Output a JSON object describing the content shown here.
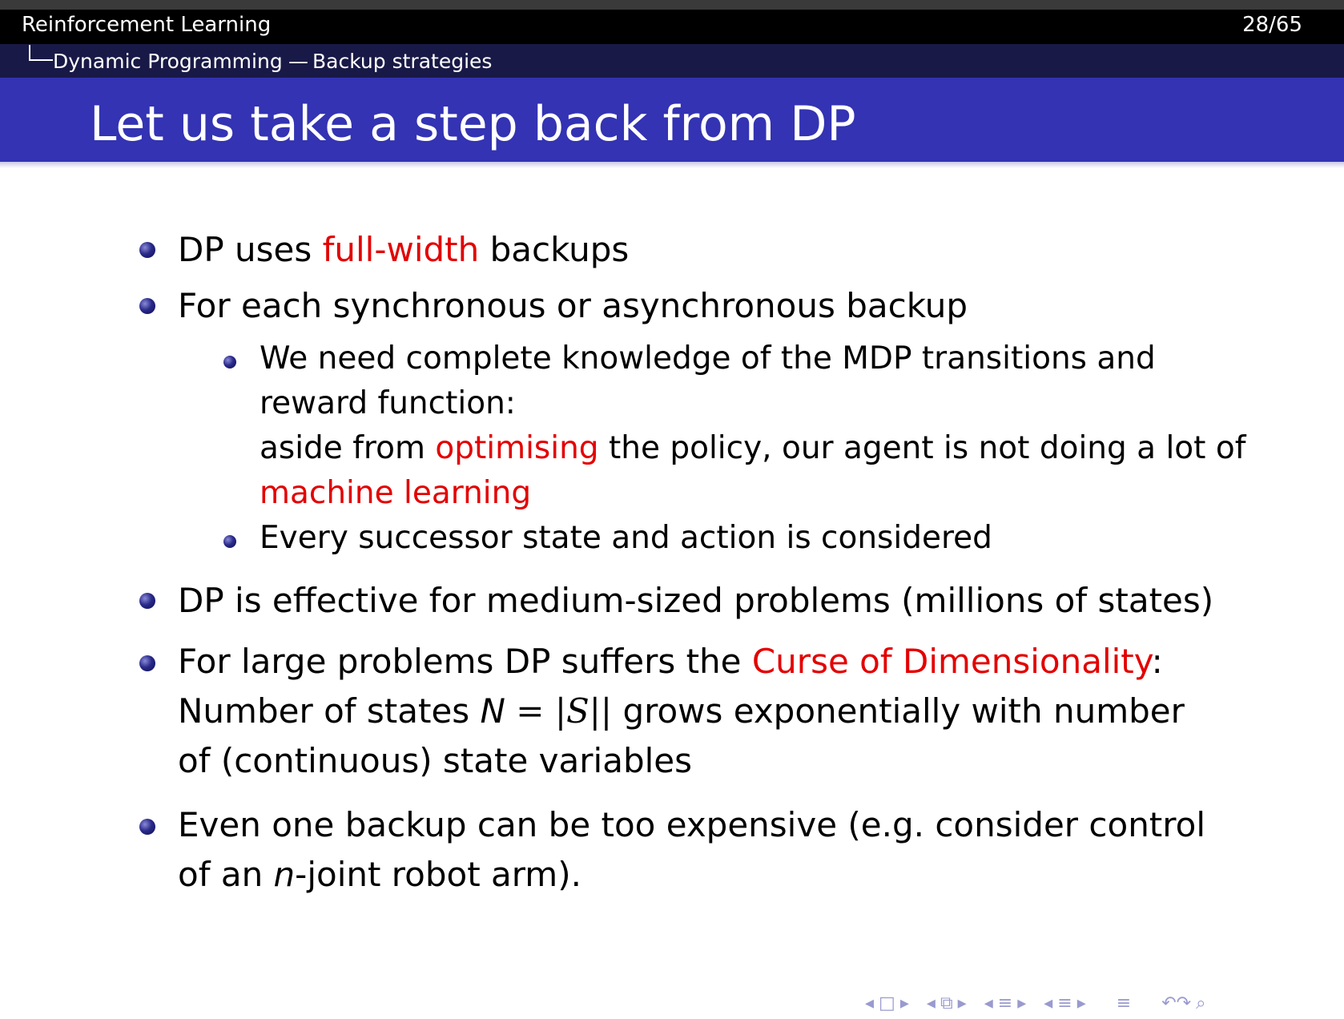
{
  "header": {
    "title": "Reinforcement Learning",
    "page": "28/65",
    "section": "Dynamic Programming",
    "dash": "—",
    "subsection": "Backup strategies"
  },
  "frame_title": "Let us take a step back from DP",
  "bullets": {
    "b1": {
      "pre": "DP uses ",
      "red": "full-width",
      "post": " backups"
    },
    "b2": {
      "text": "For each synchronous or asynchronous backup"
    },
    "b2_sub1": {
      "line1": "We need complete knowledge of the MDP transitions and",
      "line2": "reward function:",
      "line3_pre": "aside from ",
      "line3_red": "optimising",
      "line3_post": " the policy, our agent is not doing a lot of",
      "line4_red": "machine learning"
    },
    "b2_sub2": {
      "text": "Every successor state and action is considered"
    },
    "b3": {
      "text": "DP is effective for medium-sized problems (millions of states)"
    },
    "b4": {
      "pre": "For large problems DP suffers the ",
      "red": "Curse of Dimensionality",
      "post": ":",
      "line2_pre": "Number of states ",
      "line2_var": "N",
      "line2_eq": " =  |",
      "line2_set": "S",
      "line2_bars": "||",
      "line2_post": " grows exponentially with number",
      "line3": "of (continuous) state variables"
    },
    "b5": {
      "line1": "Even one backup can be too expensive (e.g.  consider control",
      "line2_pre": "of an ",
      "line2_var": "n",
      "line2_post": "-joint robot arm)."
    }
  },
  "navigation": {
    "symbols": [
      "◂",
      "□",
      "▸",
      "◂",
      "⧉",
      "▸",
      "◂",
      "≡",
      "▸",
      "◂",
      "≡",
      "▸",
      "≡",
      "↶↷",
      "⌕"
    ]
  },
  "colors": {
    "header_bg": "#000000",
    "subheader_bg": "#191947",
    "title_bg": "#3333b3",
    "highlight": "#e30000",
    "bullet": "#2a2a8a"
  }
}
